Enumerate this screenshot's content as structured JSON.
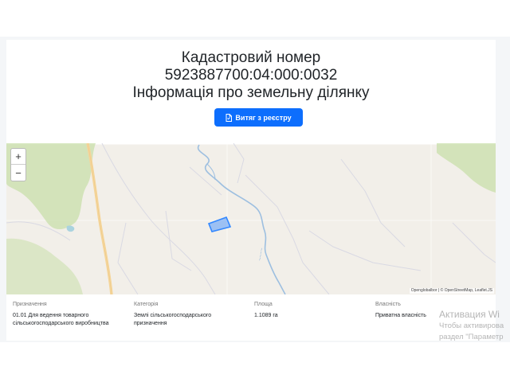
{
  "header": {
    "line1": "Кадастровий номер",
    "line2": "5923887700:04:000:0032",
    "line3": "Інформація про земельну ділянку"
  },
  "extract_button": {
    "label": "Витяг з реєстру",
    "icon": "document-icon",
    "color": "#0d6efd"
  },
  "map": {
    "zoom_in": "+",
    "zoom_out": "−",
    "attribution": "Openglobalbor | © OpenStreetMap, Leaflet.JS",
    "parcel_color": "#3388ff"
  },
  "info": {
    "purpose": {
      "label": "Призначення",
      "value": "01.01 Для ведення товарного сільськогосподарського виробництва"
    },
    "category": {
      "label": "Категорія",
      "value": "Землі сільськогосподарського призначення"
    },
    "area": {
      "label": "Площа",
      "value": "1.1089 га"
    },
    "ownership": {
      "label": "Власність",
      "value": "Приватна власність"
    }
  },
  "windows_activation": {
    "title": "Активация Wi",
    "line1": "Чтобы активирова",
    "line2": "раздел \"Параметр"
  }
}
